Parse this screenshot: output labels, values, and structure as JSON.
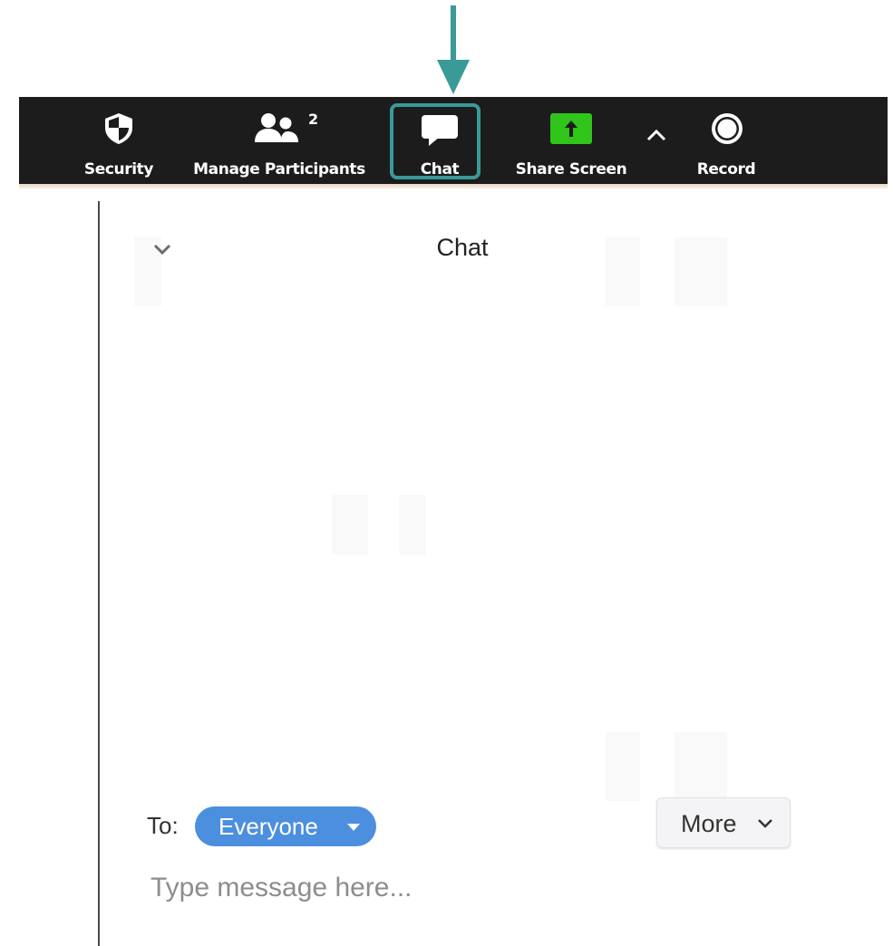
{
  "toolbar": {
    "security_label": "Security",
    "participants_label": "Manage Participants",
    "participants_count": "2",
    "chat_label": "Chat",
    "share_label": "Share Screen",
    "record_label": "Record"
  },
  "annotation": {
    "arrow_color": "#3a9a98",
    "highlight_color": "#3a9a98"
  },
  "chat_panel": {
    "title": "Chat",
    "to_label": "To:",
    "recipient": "Everyone",
    "more_label": "More",
    "input_placeholder": "Type message here..."
  },
  "colors": {
    "toolbar_bg": "#1c1c1c",
    "share_green": "#31c41b",
    "recipient_blue": "#4c8fde"
  }
}
